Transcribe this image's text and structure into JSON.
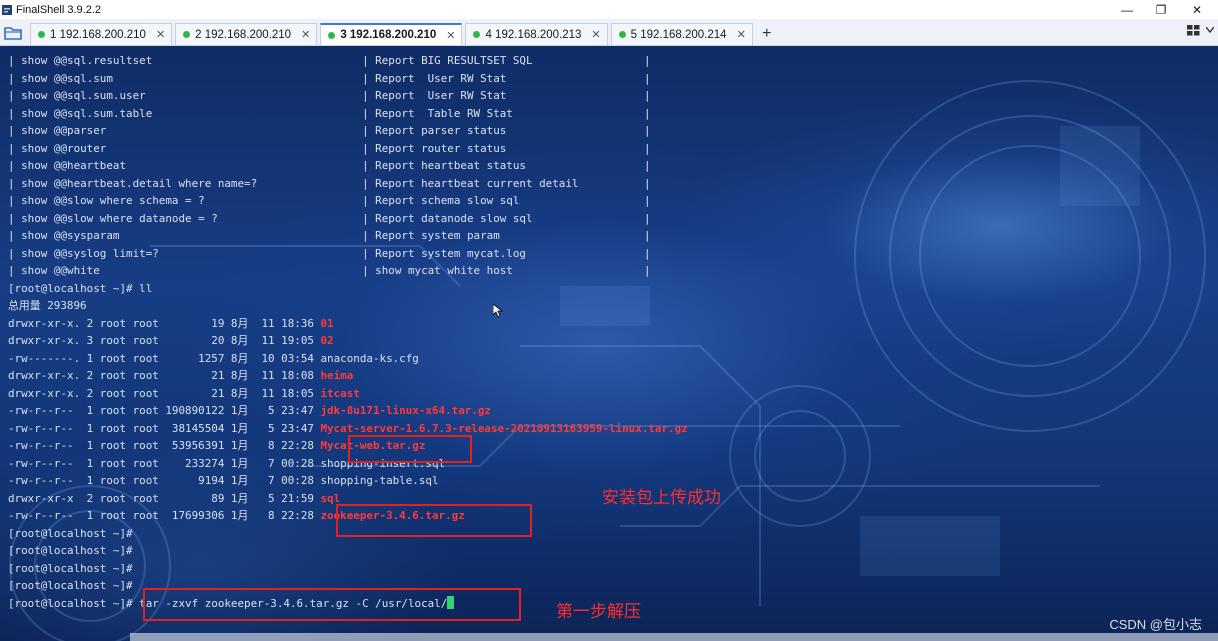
{
  "window": {
    "title": "FinalShell 3.9.2.2",
    "minimize_glyph": "—",
    "maximize_glyph": "❐",
    "close_glyph": "✕"
  },
  "tabs": [
    {
      "label": "1 192.168.200.210",
      "active": false
    },
    {
      "label": "2 192.168.200.210",
      "active": false
    },
    {
      "label": "3 192.168.200.210",
      "active": true
    },
    {
      "label": "4 192.168.200.213",
      "active": false
    },
    {
      "label": "5 192.168.200.214",
      "active": false
    }
  ],
  "tab_close_glyph": "✕",
  "add_tab_glyph": "+",
  "terminal": {
    "lines": [
      {
        "text": "| show @@sql.resultset                                | Report BIG RESULTSET SQL                 |"
      },
      {
        "text": "| show @@sql.sum                                      | Report  User RW Stat                     |"
      },
      {
        "text": "| show @@sql.sum.user                                 | Report  User RW Stat                     |"
      },
      {
        "text": "| show @@sql.sum.table                                | Report  Table RW Stat                    |"
      },
      {
        "text": "| show @@parser                                       | Report parser status                     |"
      },
      {
        "text": "| show @@router                                       | Report router status                     |"
      },
      {
        "text": "| show @@heartbeat                                    | Report heartbeat status                  |"
      },
      {
        "text": "| show @@heartbeat.detail where name=?                | Report heartbeat current detail          |"
      },
      {
        "text": "| show @@slow where schema = ?                        | Report schema slow sql                   |"
      },
      {
        "text": "| show @@slow where datanode = ?                      | Report datanode slow sql                 |"
      },
      {
        "text": "| show @@sysparam                                     | Report system param                      |"
      },
      {
        "text": "| show @@syslog limit=?                               | Report system mycat.log                  |"
      },
      {
        "text": "| show @@white                                        | show mycat white host                    |"
      },
      {
        "text": "[root@localhost ~]# ll"
      },
      {
        "text": "总用量 293896"
      },
      {
        "text": "drwxr-xr-x. 2 root root        19 8月  11 18:36 ",
        "hl": "01"
      },
      {
        "text": "drwxr-xr-x. 3 root root        20 8月  11 19:05 ",
        "hl": "02"
      },
      {
        "text": "-rw-------. 1 root root      1257 8月  10 03:54 anaconda-ks.cfg"
      },
      {
        "text": "drwxr-xr-x. 2 root root        21 8月  11 18:08 ",
        "hl": "heima"
      },
      {
        "text": "drwxr-xr-x. 2 root root        21 8月  11 18:05 ",
        "hl": "itcast"
      },
      {
        "text": "-rw-r--r--  1 root root 190890122 1月   5 23:47 ",
        "hl": "jdk-8u171-linux-x64.tar.gz"
      },
      {
        "text": "-rw-r--r--  1 root root  38145504 1月   5 23:47 ",
        "hl": "Mycat-server-1.6.7.3-release-20210913163959-linux.tar.gz"
      },
      {
        "text": "-rw-r--r--  1 root root  53956391 1月   8 22:28 ",
        "hl": "Mycat-web.tar.gz"
      },
      {
        "text": "-rw-r--r--  1 root root    233274 1月   7 00:28 shopping-insert.sql"
      },
      {
        "text": "-rw-r--r--  1 root root      9194 1月   7 00:28 shopping-table.sql"
      },
      {
        "text": "drwxr-xr-x  2 root root        89 1月   5 21:59 ",
        "hl": "sql"
      },
      {
        "text": "-rw-r--r--  1 root root  17699306 1月   8 22:28 ",
        "hl": "zookeeper-3.4.6.tar.gz"
      },
      {
        "text": "[root@localhost ~]#"
      },
      {
        "text": "[root@localhost ~]#"
      },
      {
        "text": "[root@localhost ~]#"
      },
      {
        "text": "[root@localhost ~]#"
      },
      {
        "text": "[root@localhost ~]# tar -zxvf zookeeper-3.4.6.tar.gz -C /usr/local/",
        "cursor": true
      }
    ]
  },
  "annotations": {
    "upload_success": "安装包上传成功",
    "step_one": "第一步解压"
  },
  "watermark": "CSDN @包小志"
}
